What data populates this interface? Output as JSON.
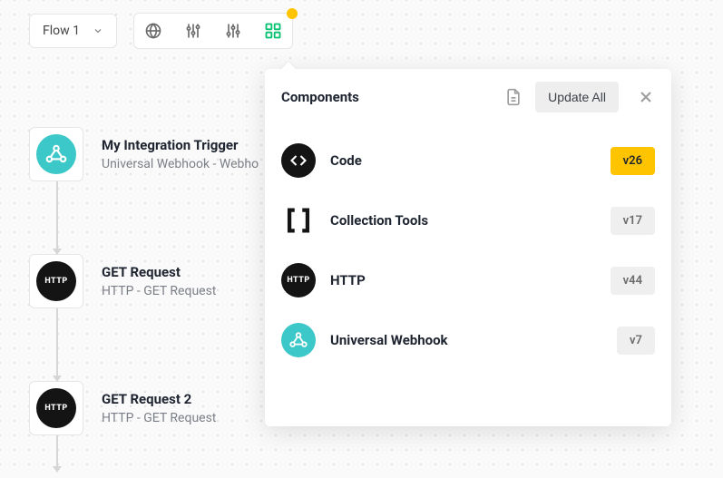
{
  "toolbar": {
    "flow_label": "Flow 1"
  },
  "flow_nodes": [
    {
      "title": "My Integration Trigger",
      "subtitle": "Universal Webhook - Webho",
      "icon": "webhook"
    },
    {
      "title": "GET Request",
      "subtitle": "HTTP - GET Request",
      "icon": "http"
    },
    {
      "title": "GET Request 2",
      "subtitle": "HTTP - GET Request",
      "icon": "http"
    }
  ],
  "panel": {
    "title": "Components",
    "update_all_label": "Update All",
    "items": [
      {
        "name": "Code",
        "version": "v26",
        "highlight": true,
        "icon": "code"
      },
      {
        "name": "Collection Tools",
        "version": "v17",
        "highlight": false,
        "icon": "brackets"
      },
      {
        "name": "HTTP",
        "version": "v44",
        "highlight": false,
        "icon": "http"
      },
      {
        "name": "Universal Webhook",
        "version": "v7",
        "highlight": false,
        "icon": "webhook"
      }
    ]
  },
  "colors": {
    "accent_yellow": "#ffc400",
    "accent_teal": "#3cc8c8",
    "accent_green": "#06c270"
  }
}
